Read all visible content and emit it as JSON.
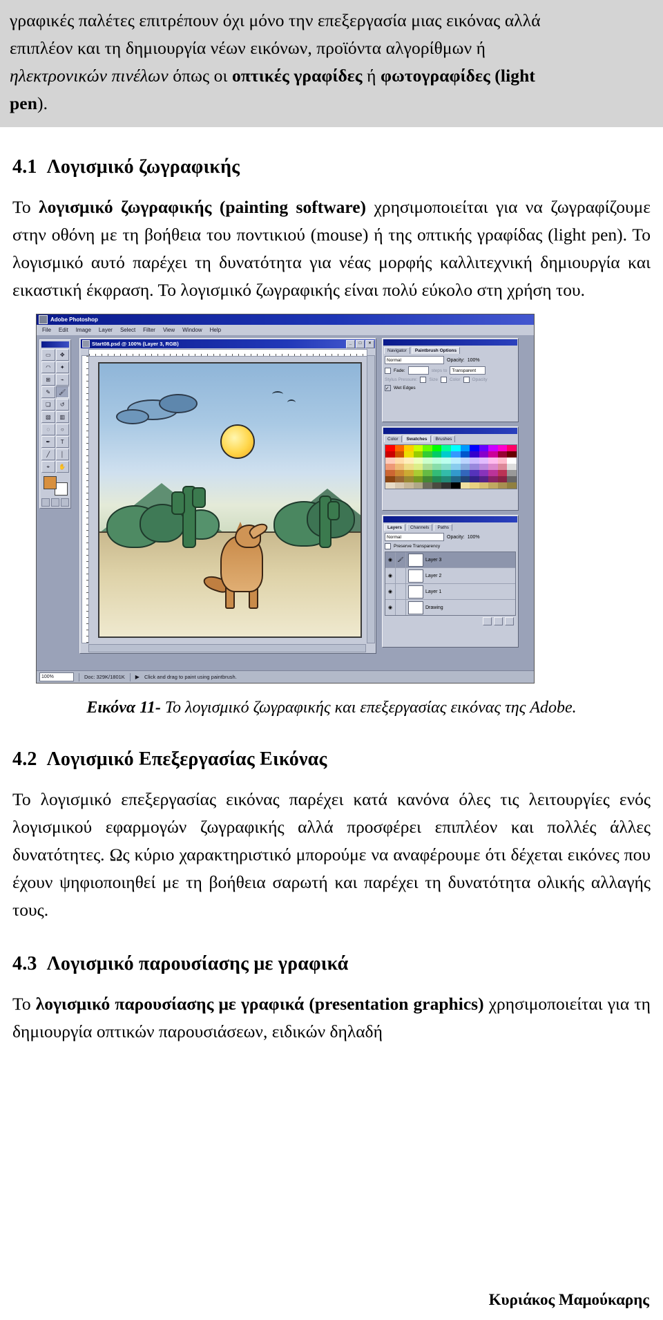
{
  "top_paragraph": {
    "line1_plain": "γραφικές παλέτες επιτρέπουν όχι μόνο την επεξεργασία μιας εικόνας αλλά",
    "line2_plain": "επιπλέον και τη δημιουργία νέων εικόνων, προϊόντα αλγορίθμων ή",
    "line3_italic_prefix": "ηλεκτρονικών πινέλων",
    "line3_plain_mid": " όπως οι ",
    "line3_bold_a": "οπτικές γραφίδες",
    "line3_plain_mid2": " ή ",
    "line3_bold_b": "φωτογραφίδες (light",
    "line4_bold": "pen",
    "line4_plain": ")."
  },
  "sections": [
    {
      "number": "4.1",
      "title": "Λογισμικό ζωγραφικής",
      "paragraph_parts": [
        {
          "text": "Το ",
          "style": "normal"
        },
        {
          "text": "λογισμικό ζωγραφικής (painting software)",
          "style": "bold"
        },
        {
          "text": " χρησιμοποιείται για να ζωγραφίζουμε στην οθόνη με τη βοήθεια του ποντικιού (mouse) ή της οπτικής γραφίδας (light pen). Το λογισμικό αυτό παρέχει τη δυνατότητα για νέας μορφής καλλιτεχνική δημιουργία και εικαστική έκφραση. Το λογισμικό ζωγραφικής είναι πολύ εύκολο στη χρήση του.",
          "style": "normal"
        }
      ]
    },
    {
      "number": "4.2",
      "title": "Λογισμικό Επεξεργασίας Εικόνας",
      "paragraph_parts": [
        {
          "text": "Το λογισμικό επεξεργασίας εικόνας παρέχει κατά κανόνα όλες τις λειτουργίες ενός λογισμικού εφαρμογών ζωγραφικής αλλά προσφέρει επιπλέον και πολλές άλλες δυνατότητες. Ως κύριο χαρακτηριστικό μπορούμε να αναφέρουμε ότι δέχεται εικόνες που έχουν ψηφιοποιηθεί με τη βοήθεια σαρωτή και παρέχει τη δυνατότητα ολικής αλλαγής τους.",
          "style": "normal"
        }
      ]
    },
    {
      "number": "4.3",
      "title": "Λογισμικό παρουσίασης με γραφικά",
      "paragraph_parts": [
        {
          "text": "Το ",
          "style": "normal"
        },
        {
          "text": "λογισμικό παρουσίασης με γραφικά (presentation graphics)",
          "style": "bold"
        },
        {
          "text": " χρησιμοποιείται για τη δημιουργία οπτικών παρουσιάσεων, ειδικών δηλαδή",
          "style": "normal"
        }
      ]
    }
  ],
  "figure": {
    "caption_label": "Εικόνα 11-",
    "caption_text": "Το λογισμικό ζωγραφικής και επεξεργασίας εικόνας της Adobe.",
    "screenshot": {
      "app_title": "Adobe Photoshop",
      "menu_items": [
        "File",
        "Edit",
        "Image",
        "Layer",
        "Select",
        "Filter",
        "View",
        "Window",
        "Help"
      ],
      "document_title": "Start08.psd @ 100% (Layer 3, RGB)",
      "window_buttons": [
        "_",
        "□",
        "×"
      ],
      "status": {
        "zoom": "100%",
        "doc_size": "Doc: 329K/1801K",
        "hint": "Click and drag to paint using paintbrush."
      },
      "toolbox_tools": [
        "marquee-tool",
        "lasso-tool",
        "magic-wand-tool",
        "move-tool",
        "airbrush-tool",
        "paintbrush-tool",
        "eraser-tool",
        "pencil-tool",
        "rubber-stamp-tool",
        "smudge-tool",
        "blur-tool",
        "dodge-tool",
        "pen-tool",
        "type-tool",
        "measure-tool",
        "line-tool",
        "gradient-tool",
        "paint-bucket-tool",
        "eyedropper-tool",
        "hand-tool"
      ],
      "palettes": [
        {
          "name": "options-palette",
          "tabs": [
            "Navigator",
            "Paintbrush Options"
          ],
          "active_tab": "Paintbrush Options",
          "blend_mode": "Normal",
          "opacity_label": "Opacity:",
          "opacity_value": "100%",
          "fade_label": "Fade:",
          "fade_steps_label": "steps to",
          "fade_target": "Transparent",
          "stylus_label": "Stylus Pressure:",
          "stylus_opts": [
            "Size",
            "Color",
            "Opacity"
          ],
          "wet_edges_label": "Wet Edges"
        },
        {
          "name": "color-palette",
          "tabs": [
            "Color",
            "Swatches",
            "Brushes"
          ],
          "active_tab": "Swatches"
        },
        {
          "name": "layers-palette",
          "tabs": [
            "Layers",
            "Channels",
            "Paths"
          ],
          "active_tab": "Layers",
          "blend_mode": "Normal",
          "opacity_label": "Opacity:",
          "opacity_value": "100%",
          "preserve_label": "Preserve Transparency",
          "layers": [
            {
              "name": "Layer 3",
              "selected": true
            },
            {
              "name": "Layer 2",
              "selected": false
            },
            {
              "name": "Layer 1",
              "selected": false
            },
            {
              "name": "Drawing",
              "selected": false
            }
          ]
        }
      ]
    }
  },
  "footer": {
    "author": "Κυριάκος Μαμούκαρης"
  }
}
